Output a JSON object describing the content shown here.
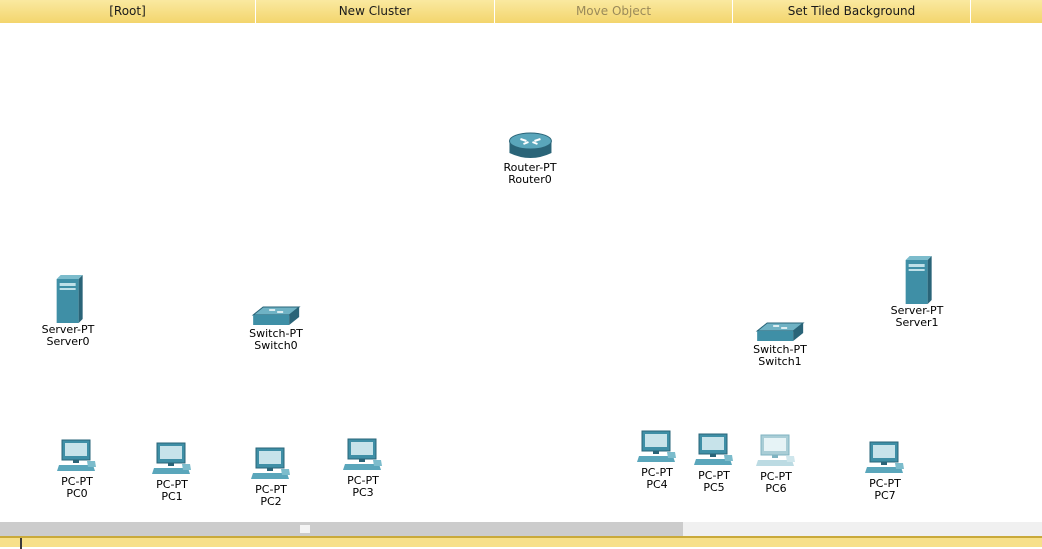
{
  "toolbar": {
    "root": "[Root]",
    "new_cluster": "New Cluster",
    "move_object": "Move Object",
    "set_tiled_background": "Set Tiled Background"
  },
  "devices": {
    "router0": {
      "type": "Router-PT",
      "name": "Router0"
    },
    "server0": {
      "type": "Server-PT",
      "name": "Server0"
    },
    "server1": {
      "type": "Server-PT",
      "name": "Server1"
    },
    "switch0": {
      "type": "Switch-PT",
      "name": "Switch0"
    },
    "switch1": {
      "type": "Switch-PT",
      "name": "Switch1"
    },
    "pc0": {
      "type": "PC-PT",
      "name": "PC0"
    },
    "pc1": {
      "type": "PC-PT",
      "name": "PC1"
    },
    "pc2": {
      "type": "PC-PT",
      "name": "PC2"
    },
    "pc3": {
      "type": "PC-PT",
      "name": "PC3"
    },
    "pc4": {
      "type": "PC-PT",
      "name": "PC4"
    },
    "pc5": {
      "type": "PC-PT",
      "name": "PC5"
    },
    "pc6": {
      "type": "PC-PT",
      "name": "PC6"
    },
    "pc7": {
      "type": "PC-PT",
      "name": "PC7"
    }
  },
  "colors": {
    "toolbar": "#f7e08a",
    "device_teal": "#3f8fa6",
    "device_dark": "#2a6478",
    "device_faded": "#a9cdd6"
  }
}
